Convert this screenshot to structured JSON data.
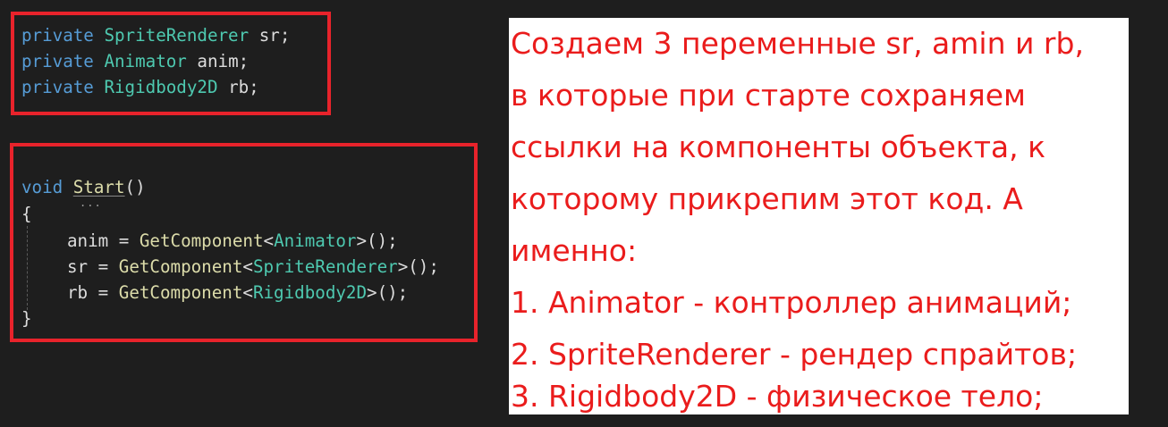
{
  "code": {
    "fields": [
      {
        "kw": "private",
        "type": "SpriteRenderer",
        "name": "sr;"
      },
      {
        "kw": "private",
        "type": "Animator",
        "name": "anim;"
      },
      {
        "kw": "private",
        "type": "Rigidbody2D",
        "name": "rb;"
      }
    ],
    "start": {
      "kw": "void",
      "method": "Start",
      "parens": "()",
      "open": "{",
      "close": "}",
      "dots": "...",
      "lines": [
        {
          "lhs": "anim = ",
          "call": "GetComponent",
          "lt": "<",
          "type": "Animator",
          "rest": ">();"
        },
        {
          "lhs": "sr = ",
          "call": "GetComponent",
          "lt": "<",
          "type": "SpriteRenderer",
          "rest": ">();"
        },
        {
          "lhs": "rb = ",
          "call": "GetComponent",
          "lt": "<",
          "type": "Rigidbody2D",
          "rest": ">();"
        }
      ]
    }
  },
  "note": {
    "lines": [
      "Создаем 3 переменные sr, amin и rb,",
      "в которые при старте сохраняем",
      "ссылки на компоненты объекта, к",
      "которому прикрепим этот код. А",
      "именно:",
      "1. Animator - контроллер анимаций;",
      "2. SpriteRenderer - рендер спрайтов;",
      "3. Rigidbody2D - физическое тело;"
    ]
  },
  "colors": {
    "background": "#1e1e1e",
    "highlight_box": "#e8232b",
    "keyword": "#569cd6",
    "type": "#4ec9b0",
    "method": "#dcdcaa",
    "note_text": "#ea1c1c",
    "note_background": "#ffffff"
  }
}
